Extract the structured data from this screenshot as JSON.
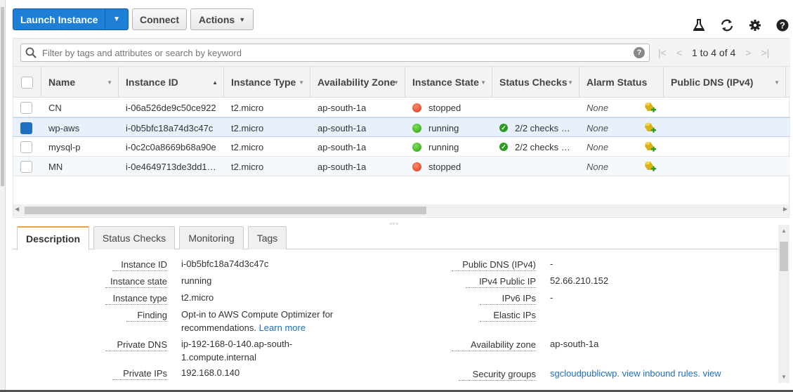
{
  "toolbar": {
    "launch_label": "Launch Instance",
    "connect_label": "Connect",
    "actions_label": "Actions"
  },
  "icons": {
    "flask": "flask-icon",
    "refresh": "refresh-icon",
    "settings": "gear-icon",
    "help": "help-icon"
  },
  "search": {
    "placeholder": "Filter by tags and attributes or search by keyword"
  },
  "pager": {
    "text": "1 to 4 of 4"
  },
  "columns": [
    "Name",
    "Instance ID",
    "Instance Type",
    "Availability Zone",
    "Instance State",
    "Status Checks",
    "Alarm Status",
    "Public DNS (IPv4)"
  ],
  "rows": [
    {
      "name": "CN",
      "id": "i-06a526de9c50ce922",
      "type": "t2.micro",
      "zone": "ap-south-1a",
      "state": "stopped",
      "checks": "",
      "alarm": "None"
    },
    {
      "name": "wp-aws",
      "id": "i-0b5bfc18a74d3c47c",
      "type": "t2.micro",
      "zone": "ap-south-1a",
      "state": "running",
      "checks": "2/2 checks …",
      "alarm": "None"
    },
    {
      "name": "mysql-p",
      "id": "i-0c2c0a8669b68a90e",
      "type": "t2.micro",
      "zone": "ap-south-1a",
      "state": "running",
      "checks": "2/2 checks …",
      "alarm": "None"
    },
    {
      "name": "MN",
      "id": "i-0e4649713de3dd1…",
      "type": "t2.micro",
      "zone": "ap-south-1a",
      "state": "stopped",
      "checks": "",
      "alarm": "None"
    }
  ],
  "tabs": [
    "Description",
    "Status Checks",
    "Monitoring",
    "Tags"
  ],
  "details": {
    "instance_id_label": "Instance ID",
    "instance_id": "i-0b5bfc18a74d3c47c",
    "instance_state_label": "Instance state",
    "instance_state": "running",
    "instance_type_label": "Instance type",
    "instance_type": "t2.micro",
    "finding_label": "Finding",
    "finding_line1": "Opt-in to AWS Compute Optimizer for",
    "finding_line2": "recommendations.",
    "finding_link": "Learn more",
    "private_dns_label": "Private DNS",
    "private_dns_line1": "ip-192-168-0-140.ap-south-",
    "private_dns_line2": "1.compute.internal",
    "private_ips_label": "Private IPs",
    "private_ips": "192.168.0.140",
    "public_dns_label": "Public DNS (IPv4)",
    "public_dns": "-",
    "ipv4_public_label": "IPv4 Public IP",
    "ipv4_public": "52.66.210.152",
    "ipv6_label": "IPv6 IPs",
    "ipv6": "-",
    "elastic_label": "Elastic IPs",
    "elastic": "",
    "az_label": "Availability zone",
    "az": "ap-south-1a",
    "sg_label": "Security groups",
    "sg_link": "sgcloudpublicwp.",
    "sg_rules_link": "view inbound rules.",
    "sg_view_link": "view"
  }
}
